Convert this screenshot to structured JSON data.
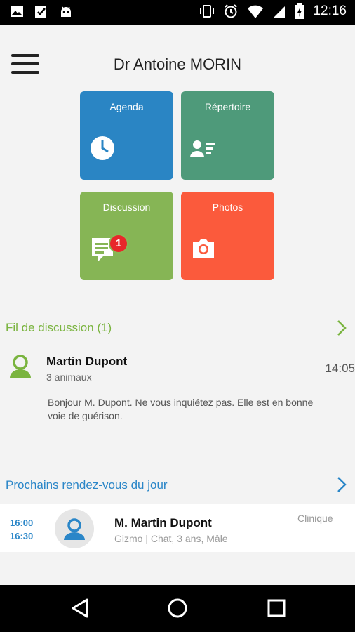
{
  "status_bar": {
    "time": "12:16"
  },
  "header": {
    "title": "Dr Antoine MORIN"
  },
  "tiles": [
    {
      "label": "Agenda",
      "color": "#2a85c4",
      "icon": "clock-icon"
    },
    {
      "label": "Répertoire",
      "color": "#4e9a7a",
      "icon": "contacts-icon"
    },
    {
      "label": "Discussion",
      "color": "#86b555",
      "icon": "chat-icon",
      "badge": "1"
    },
    {
      "label": "Photos",
      "color": "#fb5a3c",
      "icon": "camera-icon"
    }
  ],
  "discussion": {
    "heading": "Fil de discussion (1)",
    "heading_color": "#7ab43f",
    "message": {
      "name": "Martin Dupont",
      "subtitle": "3 animaux",
      "time": "14:05",
      "text": "Bonjour M. Dupont. Ne vous inquiétez pas. Elle est en bonne voie de guérison."
    }
  },
  "appointments": {
    "heading": "Prochains rendez-vous du jour",
    "heading_color": "#2a86c8",
    "items": [
      {
        "start": "16:00",
        "end": "16:30",
        "name": "M. Martin Dupont",
        "details": "Gizmo | Chat, 3 ans, Mâle",
        "place": "Clinique"
      }
    ]
  }
}
